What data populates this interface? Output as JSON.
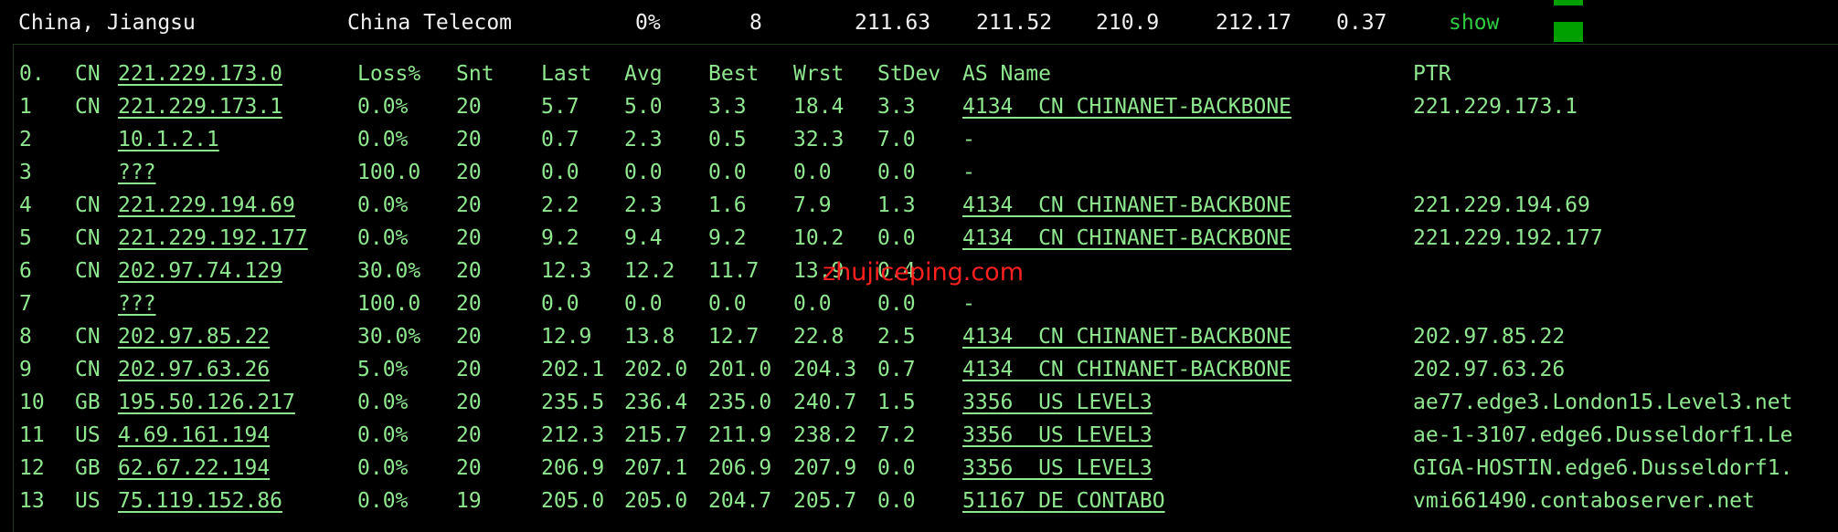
{
  "summary": {
    "location": "China, Jiangsu",
    "isp": "China Telecom",
    "loss": "0%",
    "sent": "8",
    "last": "211.63",
    "avg": "211.52",
    "best": "210.9",
    "worst": "212.17",
    "stdev": "0.37",
    "show_label": "show"
  },
  "colors": {
    "text_green": "#8fe88f",
    "bar_green": "#00a000",
    "link_green": "#2ecc40",
    "watermark_red": "#ff2020",
    "background": "#000000"
  },
  "table": {
    "origin_host": "221.229.173.0",
    "origin_index": "0.",
    "origin_cc": "CN",
    "headers": {
      "loss": "Loss%",
      "snt": "Snt",
      "last": "Last",
      "avg": "Avg",
      "best": "Best",
      "wrst": "Wrst",
      "stdev": "StDev",
      "as_name": "AS Name",
      "ptr": "PTR"
    },
    "rows": [
      {
        "n": "1",
        "cc": "CN",
        "host": "221.229.173.1",
        "loss": "0.0%",
        "snt": "20",
        "last": "5.7",
        "avg": "5.0",
        "best": "3.3",
        "wrst": "18.4",
        "stdev": "3.3",
        "as": "4134  CN CHINANET-BACKBONE",
        "ptr": "221.229.173.1"
      },
      {
        "n": "2",
        "cc": "",
        "host": "10.1.2.1",
        "loss": "0.0%",
        "snt": "20",
        "last": "0.7",
        "avg": "2.3",
        "best": "0.5",
        "wrst": "32.3",
        "stdev": "7.0",
        "as": "-",
        "ptr": ""
      },
      {
        "n": "3",
        "cc": "",
        "host": "???",
        "loss": "100.0",
        "snt": "20",
        "last": "0.0",
        "avg": "0.0",
        "best": "0.0",
        "wrst": "0.0",
        "stdev": "0.0",
        "as": "-",
        "ptr": ""
      },
      {
        "n": "4",
        "cc": "CN",
        "host": "221.229.194.69",
        "loss": "0.0%",
        "snt": "20",
        "last": "2.2",
        "avg": "2.3",
        "best": "1.6",
        "wrst": "7.9",
        "stdev": "1.3",
        "as": "4134  CN CHINANET-BACKBONE",
        "ptr": "221.229.194.69"
      },
      {
        "n": "5",
        "cc": "CN",
        "host": "221.229.192.177",
        "loss": "0.0%",
        "snt": "20",
        "last": "9.2",
        "avg": "9.4",
        "best": "9.2",
        "wrst": "10.2",
        "stdev": "0.0",
        "as": "4134  CN CHINANET-BACKBONE",
        "ptr": "221.229.192.177"
      },
      {
        "n": "6",
        "cc": "CN",
        "host": "202.97.74.129",
        "loss": "30.0%",
        "snt": "20",
        "last": "12.3",
        "avg": "12.2",
        "best": "11.7",
        "wrst": "13.9",
        "stdev": "0.4",
        "as": "",
        "ptr": ""
      },
      {
        "n": "7",
        "cc": "",
        "host": "???",
        "loss": "100.0",
        "snt": "20",
        "last": "0.0",
        "avg": "0.0",
        "best": "0.0",
        "wrst": "0.0",
        "stdev": "0.0",
        "as": "-",
        "ptr": ""
      },
      {
        "n": "8",
        "cc": "CN",
        "host": "202.97.85.22",
        "loss": "30.0%",
        "snt": "20",
        "last": "12.9",
        "avg": "13.8",
        "best": "12.7",
        "wrst": "22.8",
        "stdev": "2.5",
        "as": "4134  CN CHINANET-BACKBONE",
        "ptr": "202.97.85.22"
      },
      {
        "n": "9",
        "cc": "CN",
        "host": "202.97.63.26",
        "loss": "5.0%",
        "snt": "20",
        "last": "202.1",
        "avg": "202.0",
        "best": "201.0",
        "wrst": "204.3",
        "stdev": "0.7",
        "as": "4134  CN CHINANET-BACKBONE",
        "ptr": "202.97.63.26"
      },
      {
        "n": "10",
        "cc": "GB",
        "host": "195.50.126.217",
        "loss": "0.0%",
        "snt": "20",
        "last": "235.5",
        "avg": "236.4",
        "best": "235.0",
        "wrst": "240.7",
        "stdev": "1.5",
        "as": "3356  US LEVEL3",
        "ptr": "ae77.edge3.London15.Level3.net"
      },
      {
        "n": "11",
        "cc": "US",
        "host": "4.69.161.194",
        "loss": "0.0%",
        "snt": "20",
        "last": "212.3",
        "avg": "215.7",
        "best": "211.9",
        "wrst": "238.2",
        "stdev": "7.2",
        "as": "3356  US LEVEL3",
        "ptr": "ae-1-3107.edge6.Dusseldorf1.Le"
      },
      {
        "n": "12",
        "cc": "GB",
        "host": "62.67.22.194",
        "loss": "0.0%",
        "snt": "20",
        "last": "206.9",
        "avg": "207.1",
        "best": "206.9",
        "wrst": "207.9",
        "stdev": "0.0",
        "as": "3356  US LEVEL3",
        "ptr": "GIGA-HOSTIN.edge6.Dusseldorf1."
      },
      {
        "n": "13",
        "cc": "US",
        "host": "75.119.152.86",
        "loss": "0.0%",
        "snt": "19",
        "last": "205.0",
        "avg": "205.0",
        "best": "204.7",
        "wrst": "205.7",
        "stdev": "0.0",
        "as": "51167 DE CONTABO",
        "ptr": "vmi661490.contaboserver.net"
      }
    ]
  },
  "watermark": "zhujiceping.com"
}
